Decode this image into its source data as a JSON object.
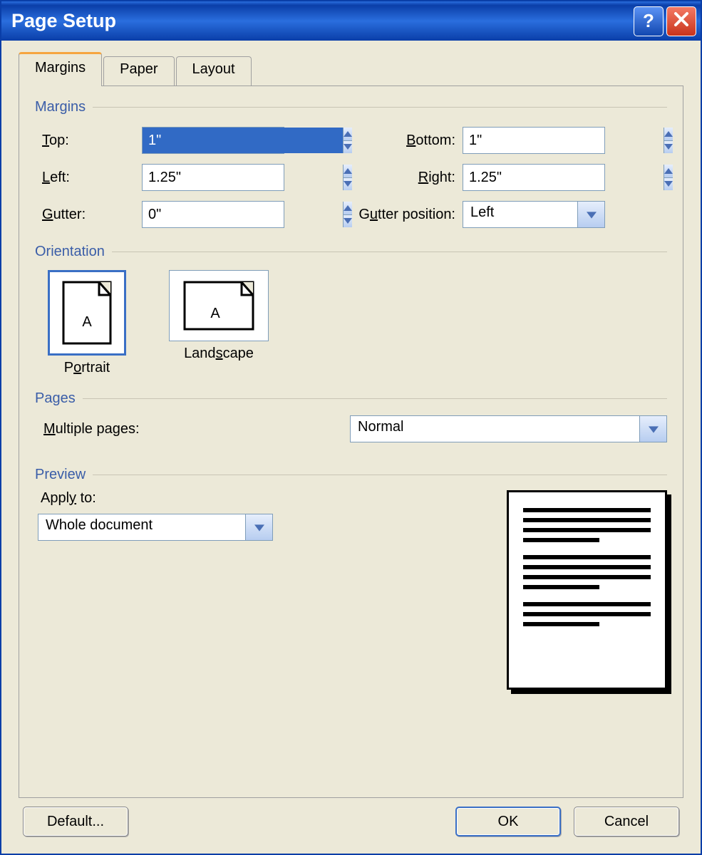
{
  "title": "Page Setup",
  "tabs": {
    "margins": "Margins",
    "paper": "Paper",
    "layout": "Layout"
  },
  "margins": {
    "section_title": "Margins",
    "top_label": "Top:",
    "top_value": "1\"",
    "bottom_label": "Bottom:",
    "bottom_value": "1\"",
    "left_label": "Left:",
    "left_value": "1.25\"",
    "right_label": "Right:",
    "right_value": "1.25\"",
    "gutter_label": "Gutter:",
    "gutter_value": "0\"",
    "gutter_pos_label": "Gutter position:",
    "gutter_pos_value": "Left"
  },
  "orientation": {
    "section_title": "Orientation",
    "portrait": "Portrait",
    "landscape": "Landscape"
  },
  "pages": {
    "section_title": "Pages",
    "multiple_label": "Multiple pages:",
    "multiple_value": "Normal"
  },
  "preview": {
    "section_title": "Preview",
    "apply_label": "Apply to:",
    "apply_value": "Whole document"
  },
  "buttons": {
    "default": "Default...",
    "ok": "OK",
    "cancel": "Cancel"
  }
}
